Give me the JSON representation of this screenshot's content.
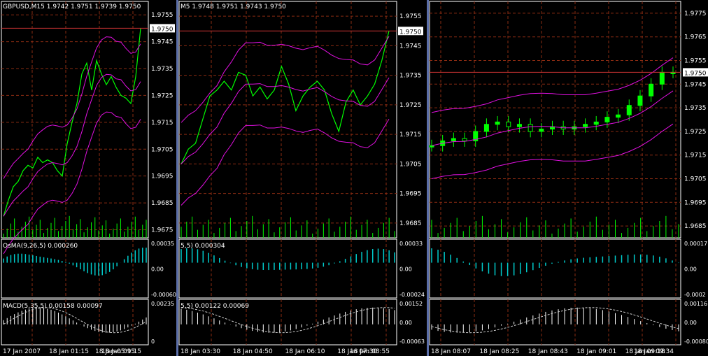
{
  "colors": {
    "background": "#000000",
    "grid": "#8a2b12",
    "frame": "#ffffff",
    "axis_text": "#ffffff",
    "price": "#00ff00",
    "bands": "#e010e0",
    "bid_line": "#c83232",
    "separator": "#5b6ea8",
    "osma": "#00cccc",
    "macd_hist": "#ffffff",
    "signal": "#cccccc",
    "volume": "#00ff00"
  },
  "windows": [
    {
      "name": "gbpusd-m15",
      "title": "GBPUSD,M15  1.9742 1.9751 1.9739 1.9750",
      "price_ticks": [
        "1.9755",
        "1.9745",
        "1.9735",
        "1.9725",
        "1.9715",
        "1.9705",
        "1.9695",
        "1.9685",
        "1.9675"
      ],
      "price_badge": "1.9750",
      "osma_label": "OsMA(9,26,5) 0.000260",
      "osma_ticks": [
        "0.00035",
        "0.00",
        "-0.00060"
      ],
      "macd_label": "MACD(5,35,5) 0.00158 0.00097",
      "macd_ticks": [
        "0.00235",
        "0"
      ],
      "time_labels": [
        "17 Jan 2007",
        "18 Jan 01:15",
        "18 Jan 05:15",
        "18 Jan 09:15"
      ],
      "chart_data": {
        "type": "line",
        "symbol": "GBPUSD",
        "timeframe": "M15",
        "open": 1.9742,
        "high": 1.9751,
        "low": 1.9739,
        "close": 1.975,
        "ylim": [
          1.9672,
          1.976
        ],
        "close_series": [
          1.968,
          1.9686,
          1.9691,
          1.9693,
          1.9697,
          1.9699,
          1.9698,
          1.9702,
          1.97,
          1.9701,
          1.97,
          1.9697,
          1.9695,
          1.9707,
          1.9715,
          1.9722,
          1.9733,
          1.9737,
          1.9727,
          1.9738,
          1.9733,
          1.9729,
          1.9732,
          1.9728,
          1.9725,
          1.9724,
          1.9722,
          1.9732,
          1.975
        ]
      }
    },
    {
      "name": "gbpusd-m5",
      "title": "M5  1.9748 1.9751 1.9743 1.9750",
      "price_ticks": [
        "1.9755",
        "1.9745",
        "1.9735",
        "1.9725",
        "1.9715",
        "1.9705",
        "1.9695",
        "1.9685"
      ],
      "price_badge": "1.9750",
      "osma_label": "5,5) 0.000304",
      "osma_ticks": [
        "0.00033",
        "0.00",
        "-0.00024"
      ],
      "macd_label": "5,5) 0.00122 0.00069",
      "macd_ticks": [
        "0.00152",
        "0.00",
        "-0.00063"
      ],
      "time_labels": [
        "18 Jan 03:30",
        "18 Jan 04:50",
        "18 Jan 06:10",
        "18 Jan 07:30",
        "18 Jan 08:55"
      ],
      "chart_data": {
        "type": "line",
        "timeframe": "M5",
        "open": 1.9748,
        "high": 1.9751,
        "low": 1.9743,
        "close": 1.975,
        "ylim": [
          1.968,
          1.976
        ],
        "close_series": [
          1.9705,
          1.971,
          1.9712,
          1.972,
          1.9728,
          1.973,
          1.9733,
          1.973,
          1.9736,
          1.9735,
          1.9728,
          1.9731,
          1.9727,
          1.973,
          1.9738,
          1.9732,
          1.9723,
          1.9728,
          1.9731,
          1.9733,
          1.973,
          1.9722,
          1.9716,
          1.9726,
          1.973,
          1.9725,
          1.9728,
          1.9732,
          1.974,
          1.975
        ]
      }
    },
    {
      "name": "gbpusd-m1",
      "title": "",
      "price_ticks": [
        "1.9775",
        "1.9765",
        "1.9755",
        "1.9745",
        "1.9735",
        "1.9725",
        "1.9715",
        "1.9705",
        "1.9695",
        "1.9685"
      ],
      "price_badge": "1.9750",
      "osma_label": "",
      "osma_ticks": [
        "0.00017",
        "0.00",
        "-0.0002"
      ],
      "macd_label": "",
      "macd_ticks": [
        "0.00116",
        "0.00",
        "-0.00080"
      ],
      "time_labels": [
        "18 Jan 08:07",
        "18 Jan 08:25",
        "18 Jan 08:43",
        "18 Jan 09:01",
        "18 Jan 09:18",
        "18 Jan 09:34"
      ],
      "chart_data": {
        "type": "candlestick",
        "ylim": [
          1.968,
          1.978
        ],
        "close_series": [
          1.9719,
          1.9721,
          1.9722,
          1.9721,
          1.9725,
          1.9728,
          1.9729,
          1.9727,
          1.9728,
          1.9725,
          1.9726,
          1.9727,
          1.9726,
          1.9727,
          1.9728,
          1.9729,
          1.9731,
          1.9732,
          1.9736,
          1.974,
          1.9745,
          1.975,
          1.975
        ]
      }
    }
  ]
}
